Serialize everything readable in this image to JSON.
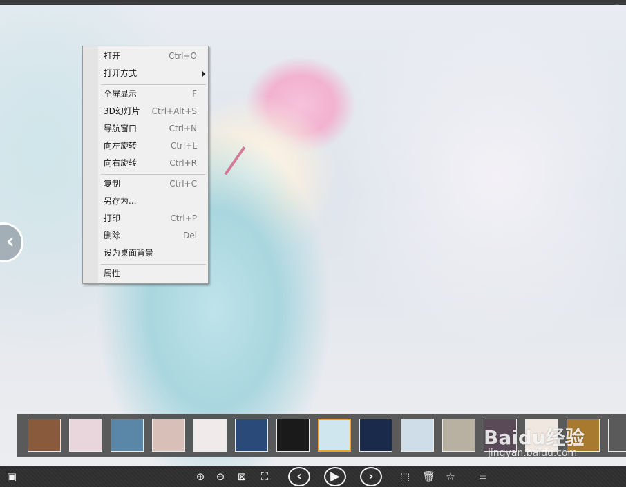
{
  "context_menu": {
    "items": [
      {
        "label": "打开",
        "shortcut": "Ctrl+O"
      },
      {
        "label": "打开方式",
        "shortcut": ""
      },
      {
        "label": "全屏显示",
        "shortcut": "F"
      },
      {
        "label": "3D幻灯片",
        "shortcut": "Ctrl+Alt+S"
      },
      {
        "label": "导航窗口",
        "shortcut": "Ctrl+N"
      },
      {
        "label": "向左旋转",
        "shortcut": "Ctrl+L"
      },
      {
        "label": "向右旋转",
        "shortcut": "Ctrl+R"
      },
      {
        "label": "复制",
        "shortcut": "Ctrl+C"
      },
      {
        "label": "另存为...",
        "shortcut": ""
      },
      {
        "label": "打印",
        "shortcut": "Ctrl+P"
      },
      {
        "label": "删除",
        "shortcut": "Del"
      },
      {
        "label": "设为桌面背景",
        "shortcut": ""
      },
      {
        "label": "属性",
        "shortcut": ""
      }
    ]
  },
  "filmstrip": {
    "selected_index": 7,
    "thumb_colors": [
      "#8a5a3c",
      "#e8d6dc",
      "#5a86a8",
      "#d8c0b8",
      "#f0eaea",
      "#2a4a7a",
      "#1a1a1a",
      "#cfe6ef",
      "#1a2a4a",
      "#cfdde8",
      "#b8b0a0",
      "#5a4a58",
      "#f0e8e0",
      "#a87a30",
      "#5a5a5a"
    ]
  },
  "icons": {
    "top": [
      "comment-icon",
      "info-icon"
    ],
    "nav": "chevron-left-icon",
    "bottom": [
      "image-icon",
      "zoom-in-icon",
      "zoom-out-icon",
      "fit-icon",
      "fullscreen-icon",
      "previous-icon",
      "play-icon",
      "next-icon",
      "crop-icon",
      "delete-icon",
      "star-icon",
      "menu-icon"
    ]
  },
  "watermark": {
    "logo": "Baidu经验",
    "url": "jingyan.baidu.com"
  }
}
